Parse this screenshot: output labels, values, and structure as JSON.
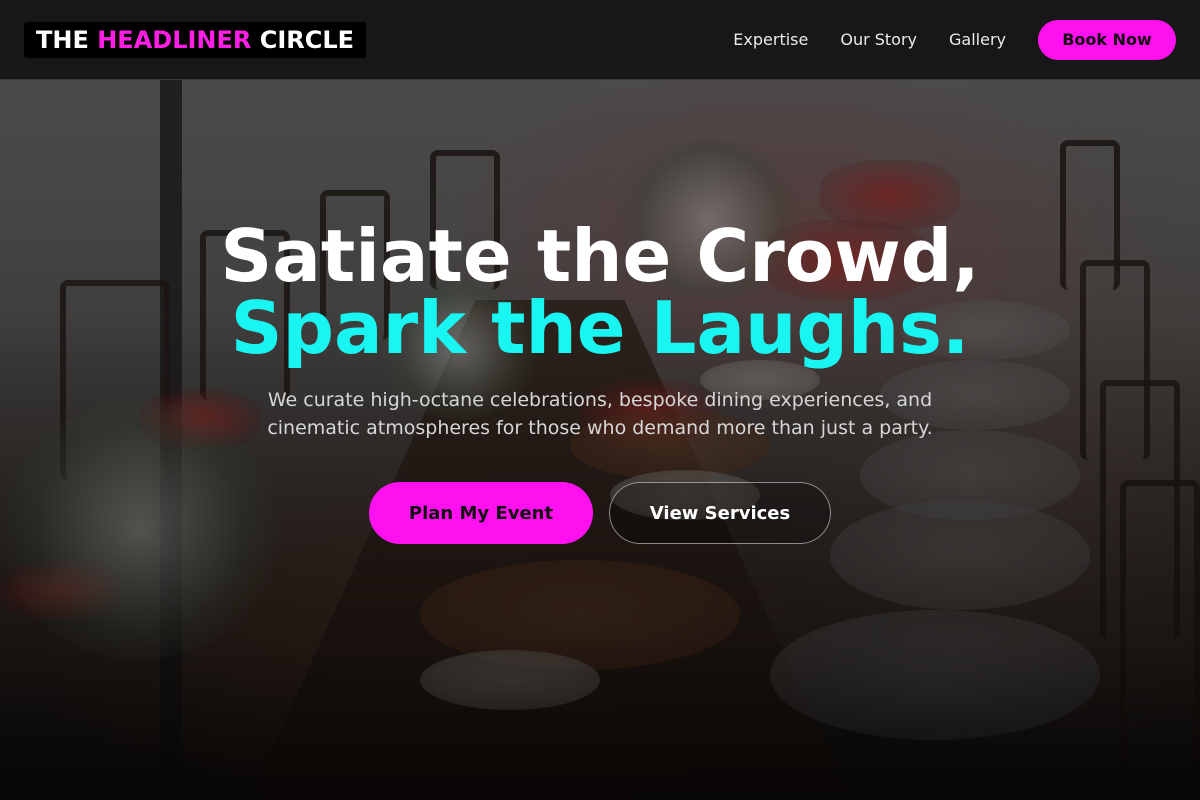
{
  "brand": {
    "logo_part1": "THE ",
    "logo_part2": "HEADLINER",
    "logo_part3": " CIRCLE",
    "accent_color": "#ff10ee",
    "highlight_color": "#19f5f0"
  },
  "nav": {
    "links": [
      {
        "label": "Expertise"
      },
      {
        "label": "Our Story"
      },
      {
        "label": "Gallery"
      }
    ],
    "cta_label": "Book Now"
  },
  "hero": {
    "headline_line1": "Satiate the Crowd,",
    "headline_line2": "Spark the Laughs.",
    "subtext": "We curate high-octane celebrations, bespoke dining experiences, and cinematic atmospheres for those who demand more than just a party.",
    "primary_cta": "Plan My Event",
    "secondary_cta": "View Services"
  }
}
